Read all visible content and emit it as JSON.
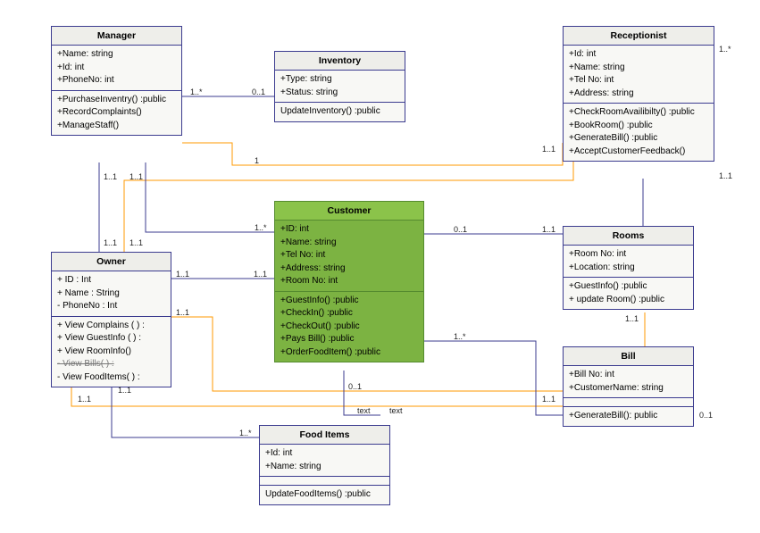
{
  "chart_data": {
    "type": "diagram",
    "diagram_type": "UML class diagram",
    "classes": [
      {
        "name": "Manager",
        "attributes": [
          "+Name: string",
          "+Id: int",
          "+PhoneNo: int"
        ],
        "methods": [
          "+PurchaseInventry() :public",
          "+RecordComplaints()",
          "+ManageStaff()"
        ]
      },
      {
        "name": "Inventory",
        "attributes": [
          "+Type: string",
          "+Status: string"
        ],
        "methods": [
          "UpdateInventory() :public"
        ]
      },
      {
        "name": "Receptionist",
        "attributes": [
          "+Id: int",
          "+Name: string",
          "+Tel No: int",
          "+Address: string"
        ],
        "methods": [
          "+CheckRoomAvailibilty() :public",
          "+BookRoom() :public",
          "+GenerateBill() :public",
          "+AcceptCustomerFeedback()"
        ]
      },
      {
        "name": "Owner",
        "attributes": [
          "+ ID : Int",
          "+ Name : String",
          "- PhoneNo : Int"
        ],
        "methods": [
          "+ View Complains ( ) :",
          "+ View GuestInfo ( ) :",
          "+ View RoomInfo()",
          "- View Bills( ) :",
          "- View FoodItems( ) :"
        ]
      },
      {
        "name": "Customer",
        "highlight": true,
        "attributes": [
          "+ID: int",
          "+Name: string",
          "+Tel No: int",
          "+Address: string",
          "+Room No: int"
        ],
        "methods": [
          "+GuestInfo() :public",
          "+CheckIn() :public",
          "+CheckOut() :public",
          "+Pays Bill() :public",
          "+OrderFoodItem() :public"
        ]
      },
      {
        "name": "Rooms",
        "attributes": [
          "+Room No: int",
          "+Location: string"
        ],
        "methods": [
          "+GuestInfo() :public",
          "+ update Room() :public"
        ]
      },
      {
        "name": "Bill",
        "attributes": [
          "+Bill No: int",
          "+CustomerName: string"
        ],
        "methods": [
          "+GenerateBill(): public"
        ]
      },
      {
        "name": "Food Items",
        "attributes": [
          "+Id: int",
          "+Name: string"
        ],
        "methods": [
          "UpdateFoodItems() :public"
        ]
      }
    ],
    "relationships": [
      {
        "from": "Manager",
        "to": "Inventory",
        "from_mult": "1..*",
        "to_mult": "0..1"
      },
      {
        "from": "Manager",
        "to": "Receptionist",
        "from_mult": "1..1",
        "to_mult": "1..1"
      },
      {
        "from": "Owner",
        "to": "Manager",
        "from_mult": "1..1",
        "to_mult": "1..1"
      },
      {
        "from": "Owner",
        "to": "Customer",
        "from_mult": "1..1",
        "to_mult": "1..1"
      },
      {
        "from": "Owner",
        "to": "Receptionist",
        "from_mult": "1..1",
        "to_mult": "1..*"
      },
      {
        "from": "Owner",
        "to": "Rooms",
        "from_mult": "1..1",
        "to_mult": "1..1"
      },
      {
        "from": "Owner",
        "to": "Bill",
        "from_mult": "1..1",
        "to_mult": "1..1"
      },
      {
        "from": "Owner",
        "to": "Food Items",
        "from_mult": "1..1",
        "to_mult": "1..*"
      },
      {
        "from": "Customer",
        "to": "Manager",
        "from_mult": "1..*",
        "to_mult": "1"
      },
      {
        "from": "Customer",
        "to": "Rooms",
        "from_mult": "0..1",
        "to_mult": "1..1"
      },
      {
        "from": "Customer",
        "to": "Bill",
        "from_mult": "1..*",
        "to_mult": "0..1"
      },
      {
        "from": "Customer",
        "to": "Food Items",
        "from_mult": "0..1",
        "to_mult": "text",
        "mid_label": "text"
      },
      {
        "from": "Receptionist",
        "to": "Rooms",
        "from_mult": "",
        "to_mult": ""
      }
    ]
  },
  "labels": {
    "l1a": "1..*",
    "l1b": "0..1",
    "l2a": "1",
    "l2b": "1..1",
    "l3a": "1..1",
    "l3b": "1..1",
    "l4a": "1..1",
    "l4b": "1..1",
    "l5a": "1..1",
    "l5b": "1..1",
    "l6a": "1..1",
    "l6b": "1..*",
    "l7a": "1..1",
    "l7b": "1..1",
    "l8a": "1..1",
    "l8b": "1..1",
    "l9a": "1..1",
    "l9b": "1..*",
    "l10a": "1..*",
    "l11a": "0..1",
    "l11b": "1..1",
    "l12a": "1..*",
    "l12b": "0..1",
    "l13a": "0..1",
    "l13b": "text",
    "l13c": "text"
  }
}
